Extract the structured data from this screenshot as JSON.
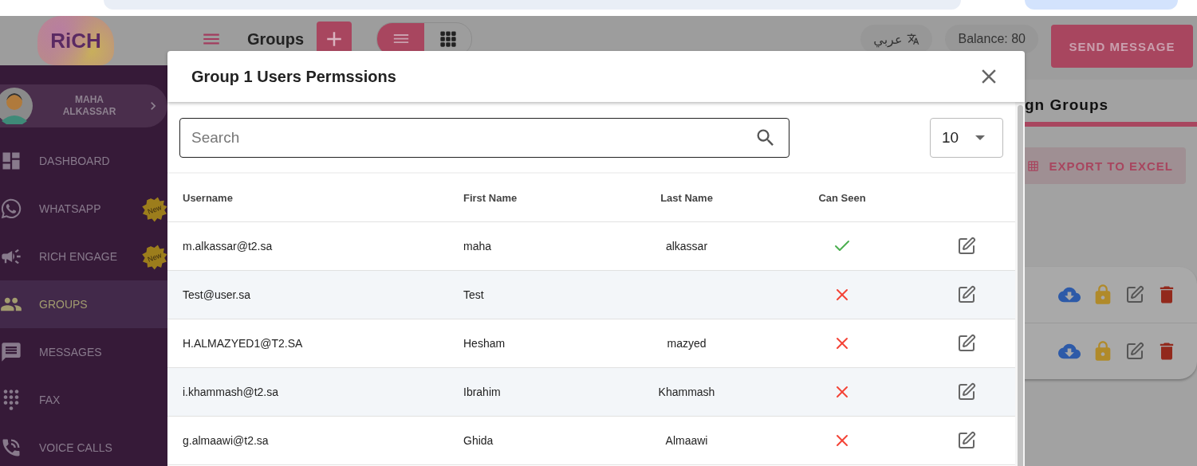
{
  "logo": "RiCH",
  "header": {
    "title": "Groups",
    "view_toggle": [
      {
        "kind": "list",
        "selected": true
      },
      {
        "kind": "grid",
        "selected": false
      }
    ],
    "language": "عربي",
    "balance": "Balance: 80",
    "send_button": "SEND MESSAGE"
  },
  "sidebar": {
    "user": "MAHA ALKASSAR",
    "items": [
      {
        "kind": "dashboard",
        "label": "DASHBOARD",
        "selected": false
      },
      {
        "kind": "whatsapp",
        "label": "WHATSAPP",
        "badge": "New",
        "selected": false
      },
      {
        "kind": "engage",
        "label": "RICH ENGAGE",
        "badge": "New",
        "selected": false
      },
      {
        "kind": "groups",
        "label": "GROUPS",
        "selected": true
      },
      {
        "kind": "messages",
        "label": "MESSAGES",
        "selected": false
      },
      {
        "kind": "fax",
        "label": "FAX",
        "selected": false
      },
      {
        "kind": "voice",
        "label": "VOICE CALLS",
        "selected": false
      }
    ]
  },
  "panel": {
    "title": "gn Groups",
    "export_button": "EXPORT TO EXCEL",
    "group_rows": [
      {
        "kind": "group"
      },
      {
        "kind": "group"
      }
    ]
  },
  "modal": {
    "title": "Group 1 Users Permssions",
    "search": {
      "placeholder": "Search"
    },
    "page_size": "10",
    "columns": [
      "Username",
      "First Name",
      "Last Name",
      "Can Seen"
    ],
    "rows": [
      {
        "username": "m.alkassar@t2.sa",
        "first_name": "maha",
        "last_name": "alkassar",
        "can_seen": true
      },
      {
        "username": "Test@user.sa",
        "first_name": "Test",
        "can_seen": false
      },
      {
        "username": "H.ALMAZYED1@T2.SA",
        "first_name": "Hesham",
        "last_name": "mazyed",
        "can_seen": false
      },
      {
        "username": "i.khammash@t2.sa",
        "first_name": "Ibrahim",
        "last_name": "Khammash",
        "can_seen": false
      },
      {
        "username": "g.almaawi@t2.sa",
        "first_name": "Ghida",
        "last_name": "Almaawi",
        "can_seen": false
      }
    ]
  }
}
